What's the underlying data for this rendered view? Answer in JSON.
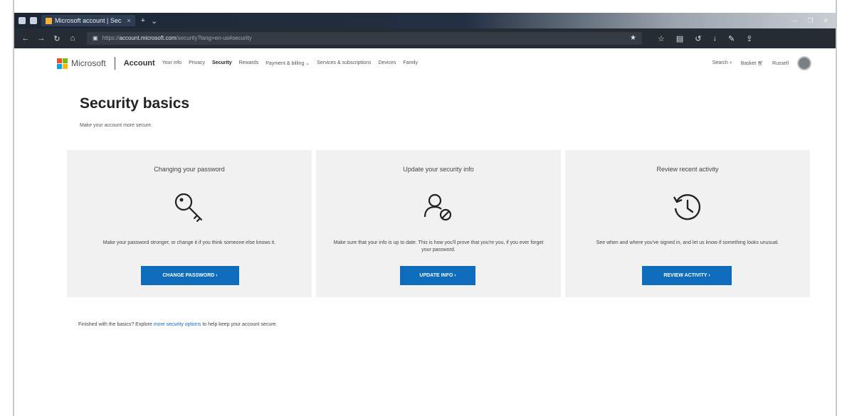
{
  "browser": {
    "tab_title": "Microsoft account | Sec",
    "tab_close": "×",
    "tab_new": "+",
    "tab_menu": "⌄",
    "url_scheme": "https://",
    "url_host": "account.microsoft.com",
    "url_path": "/security?lang=en-us#security",
    "window_controls": [
      "—",
      "❐",
      "✕"
    ]
  },
  "site": {
    "brand": "Microsoft",
    "section": "Account",
    "nav": [
      "Your info",
      "Privacy",
      "Security",
      "Rewards",
      "Payment & billing ⌄",
      "Services & subscriptions",
      "Devices",
      "Family"
    ],
    "active_nav": "Security",
    "search_label": "Search",
    "cart_label": "Basket",
    "user_label": "Russell",
    "logo_colors": [
      "#f25022",
      "#7fba00",
      "#00a4ef",
      "#ffb900"
    ]
  },
  "page": {
    "title": "Security basics",
    "subtitle": "Make your account more secure."
  },
  "cards": [
    {
      "title": "Changing your password",
      "icon": "key-icon",
      "desc": "Make your password stronger, or change it if you think someone else knows it.",
      "button": "CHANGE PASSWORD ›"
    },
    {
      "title": "Update your security info",
      "icon": "person-blocked-icon",
      "desc": "Make sure that your info is up to date. This is how you'll prove that you're you, if you ever forget your password.",
      "button": "UPDATE INFO ›"
    },
    {
      "title": "Review recent activity",
      "icon": "history-icon",
      "desc": "See when and where you've signed in, and let us know if something looks unusual.",
      "button": "REVIEW ACTIVITY ›"
    }
  ],
  "footer": {
    "prefix": "Finished with the basics? Explore",
    "link": "more security options",
    "suffix": "to help keep your account secure."
  },
  "colors": {
    "accent": "#0f6cbd",
    "card_bg": "#f1f1f1"
  }
}
